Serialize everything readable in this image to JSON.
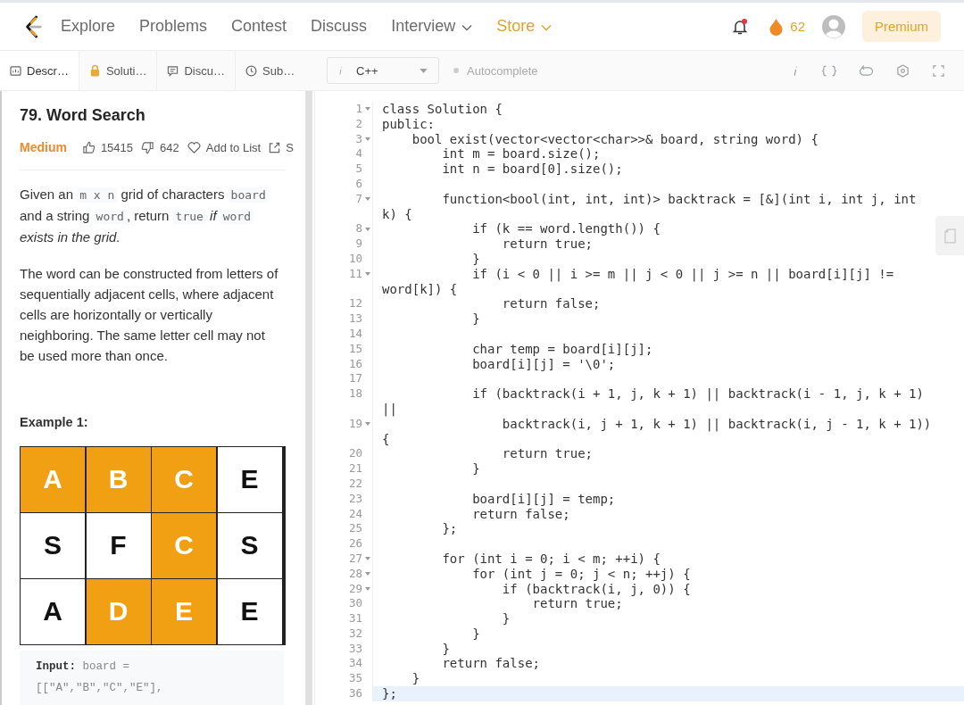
{
  "nav": {
    "links": [
      {
        "label": "Explore",
        "dropdown": false,
        "color": "#6b6b6b"
      },
      {
        "label": "Problems",
        "dropdown": false,
        "color": "#6b6b6b"
      },
      {
        "label": "Contest",
        "dropdown": false,
        "color": "#6b6b6b"
      },
      {
        "label": "Discuss",
        "dropdown": false,
        "color": "#6b6b6b"
      },
      {
        "label": "Interview",
        "dropdown": true,
        "color": "#6b6b6b"
      },
      {
        "label": "Store",
        "dropdown": true,
        "color": "#e0a526"
      }
    ],
    "notification_dot": true,
    "streak": "62",
    "premium": "Premium"
  },
  "tabs": [
    {
      "label": "Descr…",
      "kind": "description",
      "selected": true
    },
    {
      "label": "Soluti…",
      "kind": "locked",
      "selected": false
    },
    {
      "label": "Discu…",
      "kind": "discuss",
      "selected": false
    },
    {
      "label": "Sub…",
      "kind": "history",
      "selected": false
    }
  ],
  "editor_toolbar": {
    "language": "C++",
    "autocomplete": "Autocomplete"
  },
  "problem": {
    "title": "79. Word Search",
    "difficulty": "Medium",
    "likes": "15415",
    "dislikes": "642",
    "add_to_list": "Add to List",
    "share": "S",
    "paragraphs": [
      [
        {
          "t": "Given an ",
          "kind": "text"
        },
        {
          "t": "m x n",
          "kind": "code"
        },
        {
          "t": " grid of characters ",
          "kind": "text"
        },
        {
          "t": "board",
          "kind": "code"
        },
        {
          "t": " and a string ",
          "kind": "text"
        },
        {
          "t": "word",
          "kind": "code"
        },
        {
          "t": ", return ",
          "kind": "text"
        },
        {
          "t": "true",
          "kind": "code"
        },
        {
          "t": " if ",
          "kind": "italic"
        },
        {
          "t": "word",
          "kind": "code"
        },
        {
          "t": " exists in the grid.",
          "kind": "italic"
        }
      ],
      [
        {
          "t": "The word can be constructed from letters of sequentially adjacent cells, where adjacent cells are horizontally or vertically neighboring. The same letter cell may not be used more than once.",
          "kind": "text"
        }
      ]
    ],
    "example_title": "Example 1:",
    "grid": [
      [
        {
          "letter": "A",
          "on": true
        },
        {
          "letter": "B",
          "on": true
        },
        {
          "letter": "C",
          "on": true
        },
        {
          "letter": "E",
          "on": false
        }
      ],
      [
        {
          "letter": "S",
          "on": false
        },
        {
          "letter": "F",
          "on": false
        },
        {
          "letter": "C",
          "on": true
        },
        {
          "letter": "S",
          "on": false
        }
      ],
      [
        {
          "letter": "A",
          "on": false
        },
        {
          "letter": "D",
          "on": true
        },
        {
          "letter": "E",
          "on": true
        },
        {
          "letter": "E",
          "on": false
        }
      ]
    ],
    "example_input": {
      "label": "Input:",
      "lines": [
        "board =",
        "[[\"A\",\"B\",\"C\",\"E\"],"
      ]
    }
  },
  "code": [
    {
      "n": "1",
      "fold": true,
      "text": "class Solution {"
    },
    {
      "n": "2",
      "fold": false,
      "text": "public:"
    },
    {
      "n": "3",
      "fold": true,
      "text": "    bool exist(vector<vector<char>>& board, string word) {"
    },
    {
      "n": "4",
      "fold": false,
      "text": "        int m = board.size();"
    },
    {
      "n": "5",
      "fold": false,
      "text": "        int n = board[0].size();"
    },
    {
      "n": "6",
      "fold": false
    },
    {
      "n": "7",
      "fold": true,
      "text": "        function<bool(int, int, int)> backtrack = [&](int i, int j, int",
      "wrap": "k) {"
    },
    {
      "n": "8",
      "fold": true,
      "text": "            if (k == word.length()) {"
    },
    {
      "n": "9",
      "fold": false,
      "text": "                return true;"
    },
    {
      "n": "10",
      "fold": false,
      "text": "            }"
    },
    {
      "n": "11",
      "fold": true,
      "text": "            if (i < 0 || i >= m || j < 0 || j >= n || board[i][j] !=",
      "wrap": "word[k]) {"
    },
    {
      "n": "12",
      "fold": false,
      "text": "                return false;"
    },
    {
      "n": "13",
      "fold": false,
      "text": "            }"
    },
    {
      "n": "14",
      "fold": false
    },
    {
      "n": "15",
      "fold": false,
      "text": "            char temp = board[i][j];"
    },
    {
      "n": "16",
      "fold": false,
      "text": "            board[i][j] = '\\0';"
    },
    {
      "n": "17",
      "fold": false
    },
    {
      "n": "18",
      "fold": false,
      "text": "            if (backtrack(i + 1, j, k + 1) || backtrack(i - 1, j, k + 1)",
      "wrap": "||"
    },
    {
      "n": "19",
      "fold": true,
      "text": "                backtrack(i, j + 1, k + 1) || backtrack(i, j - 1, k + 1))",
      "wrap": "{"
    },
    {
      "n": "20",
      "fold": false,
      "text": "                return true;"
    },
    {
      "n": "21",
      "fold": false,
      "text": "            }"
    },
    {
      "n": "22",
      "fold": false
    },
    {
      "n": "23",
      "fold": false,
      "text": "            board[i][j] = temp;"
    },
    {
      "n": "24",
      "fold": false,
      "text": "            return false;"
    },
    {
      "n": "25",
      "fold": false,
      "text": "        };"
    },
    {
      "n": "26",
      "fold": false
    },
    {
      "n": "27",
      "fold": true,
      "text": "        for (int i = 0; i < m; ++i) {"
    },
    {
      "n": "28",
      "fold": true,
      "text": "            for (int j = 0; j < n; ++j) {"
    },
    {
      "n": "29",
      "fold": true,
      "text": "                if (backtrack(i, j, 0)) {"
    },
    {
      "n": "30",
      "fold": false,
      "text": "                    return true;"
    },
    {
      "n": "31",
      "fold": false,
      "text": "                }"
    },
    {
      "n": "32",
      "fold": false,
      "text": "            }"
    },
    {
      "n": "33",
      "fold": false,
      "text": "        }"
    },
    {
      "n": "34",
      "fold": false,
      "text": "        return false;"
    },
    {
      "n": "35",
      "fold": false,
      "text": "    }"
    },
    {
      "n": "36",
      "fold": false,
      "current": true,
      "text": "};"
    }
  ]
}
